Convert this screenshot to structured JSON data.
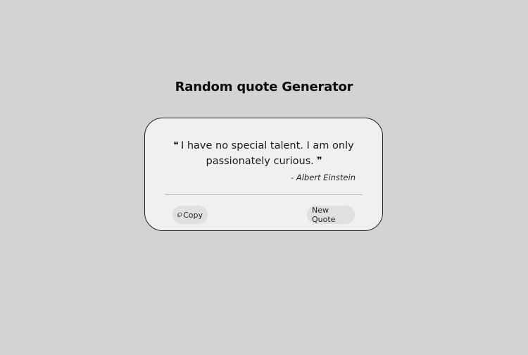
{
  "page": {
    "title": "Random quote Generator"
  },
  "quote": {
    "open_mark": "❝",
    "text": "I have no special talent. I am only passionately curious.",
    "close_mark": "❞",
    "author": "- Albert Einstein"
  },
  "actions": {
    "copy_icon": "copy-icon",
    "copy_label": "Copy",
    "new_quote_label": "New Quote"
  },
  "colors": {
    "background": "#d3d3d3",
    "card": "#f0f0f0",
    "button": "#e0e0e0"
  }
}
